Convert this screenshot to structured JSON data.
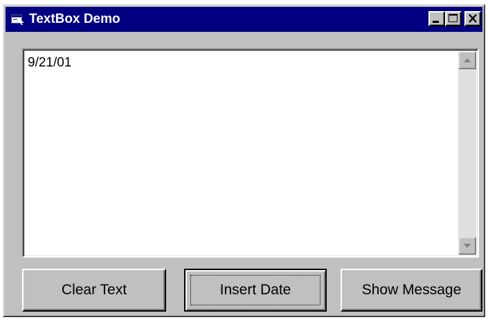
{
  "window": {
    "title": "TextBox Demo",
    "icon": "vb-form-icon",
    "controls": [
      "minimize-icon",
      "maximize-icon",
      "close-icon"
    ]
  },
  "textbox": {
    "value": "9/21/01",
    "scrollbar": {
      "up_icon": "scroll-up-arrow-icon",
      "down_icon": "scroll-down-arrow-icon"
    }
  },
  "buttons": {
    "clear_text": "Clear Text",
    "insert_date": "Insert Date",
    "show_message": "Show Message"
  },
  "focused_button": "Insert Date",
  "colors": {
    "titlebar": "#000080",
    "window_face": "#c0c0c0",
    "textbox_bg": "#ffffff"
  }
}
